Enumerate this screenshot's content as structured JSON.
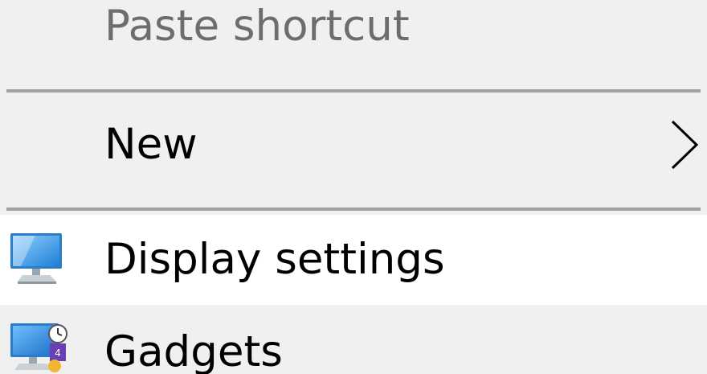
{
  "menu": {
    "items": [
      {
        "label": "Paste shortcut",
        "enabled": false
      },
      {
        "label": "New",
        "has_submenu": true
      },
      {
        "label": "Display settings",
        "icon": "display-icon",
        "highlighted": true
      },
      {
        "label": "Gadgets",
        "icon": "gadgets-icon"
      }
    ]
  },
  "colors": {
    "menu_background": "#f0f0f0",
    "highlight_background": "#ffffff",
    "separator": "#a0a0a0",
    "disabled_text": "#6d6d6d",
    "text": "#000000",
    "monitor_blue": "#2f8fdc"
  }
}
